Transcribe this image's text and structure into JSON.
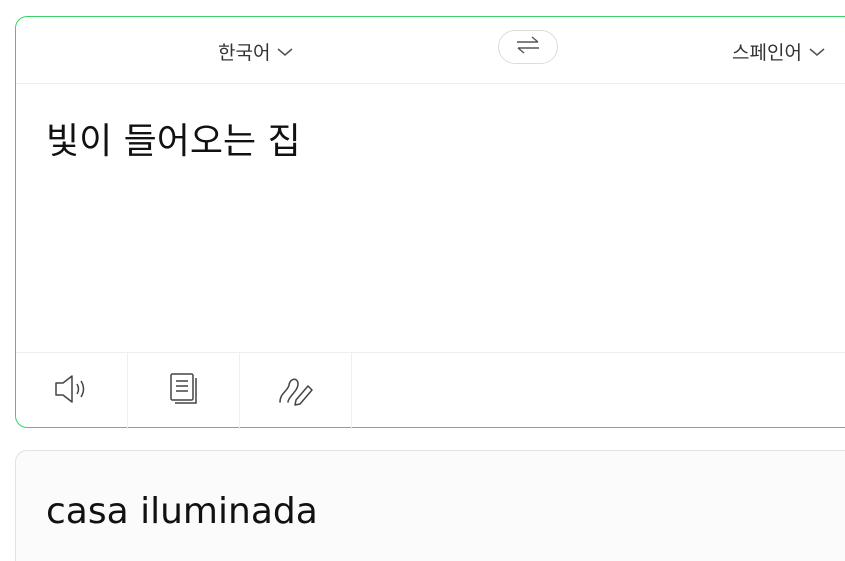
{
  "source_language": "한국어",
  "target_language": "스페인어",
  "source_text": "빛이 들어오는 집",
  "result_text": "casa iluminada",
  "icons": {
    "swap": "swap-arrows-icon",
    "chevron": "chevron-down-icon",
    "speaker": "speaker-icon",
    "copy": "copy-document-icon",
    "handwriting": "handwriting-pen-icon"
  },
  "colors": {
    "active_border": "#39d26b",
    "divider": "#efefef",
    "result_background": "#fbfbfb"
  }
}
